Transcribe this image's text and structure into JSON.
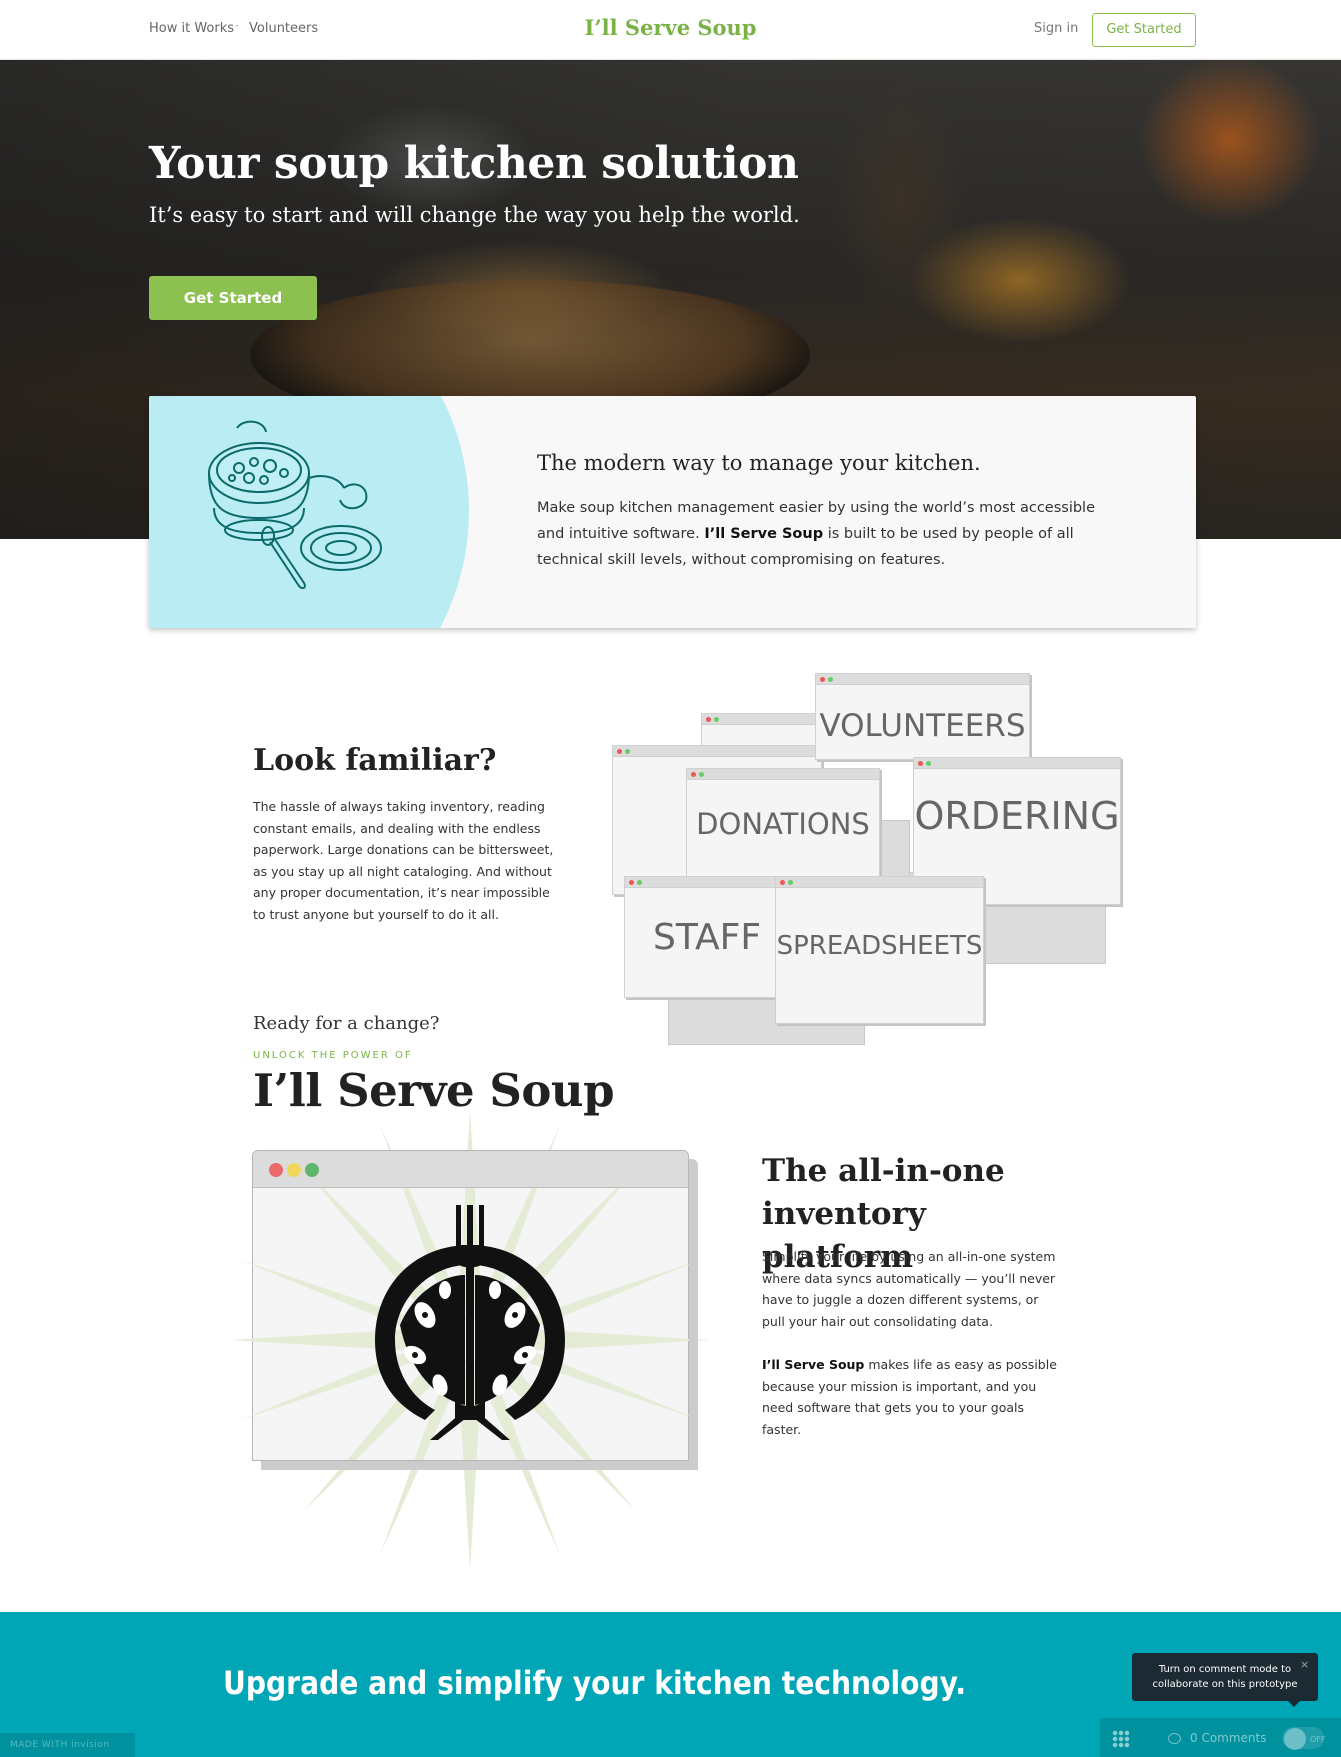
{
  "nav": {
    "links": [
      "How it Works",
      "Volunteers"
    ],
    "separator": "·",
    "brand": "I’ll Serve Soup",
    "sign_in": "Sign in",
    "cta": "Get Started"
  },
  "hero": {
    "title": "Your soup kitchen solution",
    "subtitle": "It’s easy to start and will change the way you help the world.",
    "cta": "Get Started"
  },
  "intro": {
    "illustration_icon": "soup-pot-icon",
    "title": "The modern way to manage your kitchen.",
    "text_before": "Make soup kitchen management easier by using the world’s most accessible and intuitive software. ",
    "text_bold": "I’ll Serve Soup",
    "text_after": " is built to be used by people of all technical skill levels, without compromising on features."
  },
  "familiar": {
    "title": "Look familiar?",
    "text": "The hassle of always taking inventory, reading constant emails, and dealing with the endless paperwork. Large donations can be bittersweet, as you stay up all night cataloging. And without any proper documentation, it’s near impossible to trust anyone but yourself to do it all.",
    "windows": [
      "VOLUNTEERS",
      "DONATIONS",
      "ORDERING",
      "STAFF",
      "SPREADSHEETS"
    ]
  },
  "unlock": {
    "ready": "Ready for a change?",
    "eyebrow": "UNLOCK THE POWER OF",
    "brand": "I’ll Serve Soup",
    "logo_icon": "fork-hands-logo-icon"
  },
  "platform": {
    "title": "The all-in-one inventory platform",
    "p1": "Simplify your life by using an all-in-one system where data syncs automatically — you’ll never have to juggle a dozen different systems, or pull your hair out consolidating data.",
    "p2_bold": "I’ll Serve Soup",
    "p2_rest": " makes life as easy as possible because your mission is important, and you need software that gets you to your goals faster."
  },
  "footer": {
    "title": "Upgrade and simplify your kitchen technology."
  },
  "invision": {
    "made_with": "MADE WITH",
    "brand": "invision",
    "tooltip": "Turn on comment mode to collaborate on this prototype",
    "close": "×",
    "comments": "0 Comments",
    "toggle": "OFF"
  },
  "colors": {
    "brand_green": "#7bb247",
    "button_green": "#8cc152",
    "light_blue": "#b9ecf3",
    "teal": "#00a5b6",
    "dark_teal_line": "#0b6b6b"
  }
}
